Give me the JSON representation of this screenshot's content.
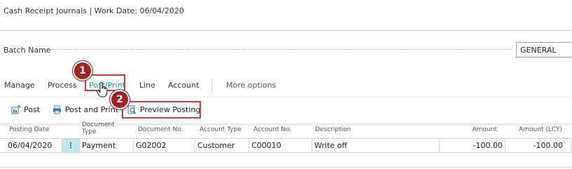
{
  "page": {
    "title": "Cash Receipt Journals | Work Date: 06/04/2020"
  },
  "batch": {
    "label": "Batch Name",
    "value": "GENERAL"
  },
  "actionbar": {
    "tabs": [
      "Manage",
      "Process",
      "Post/Print",
      "Line",
      "Account"
    ],
    "active_tab": "Post/Print",
    "more": "More options"
  },
  "submenu": {
    "items": [
      {
        "label": "Post",
        "icon": "post-icon"
      },
      {
        "label": "Post and Print",
        "icon": "printer-icon"
      },
      {
        "label": "Preview Posting",
        "icon": "preview-icon"
      }
    ]
  },
  "callouts": [
    "1",
    "2"
  ],
  "table": {
    "headers": [
      "Posting Date",
      "Document Type",
      "Document No.",
      "Account Type",
      "Account No.",
      "Description",
      "Amount",
      "Amount (LCY)"
    ],
    "rows": [
      {
        "posting_date": "06/04/2020",
        "menu": "⋮",
        "document_type": "Payment",
        "document_no": "G02002",
        "account_type": "Customer",
        "account_no": "C00010",
        "description": "Write off",
        "amount": "-100.00",
        "amount_lcy": "-100.00"
      }
    ]
  },
  "colors": {
    "accent": "#00a3d0",
    "highlight": "#e0363b",
    "callout": "#9c2422",
    "selected_cell": "#bfe8ee"
  }
}
